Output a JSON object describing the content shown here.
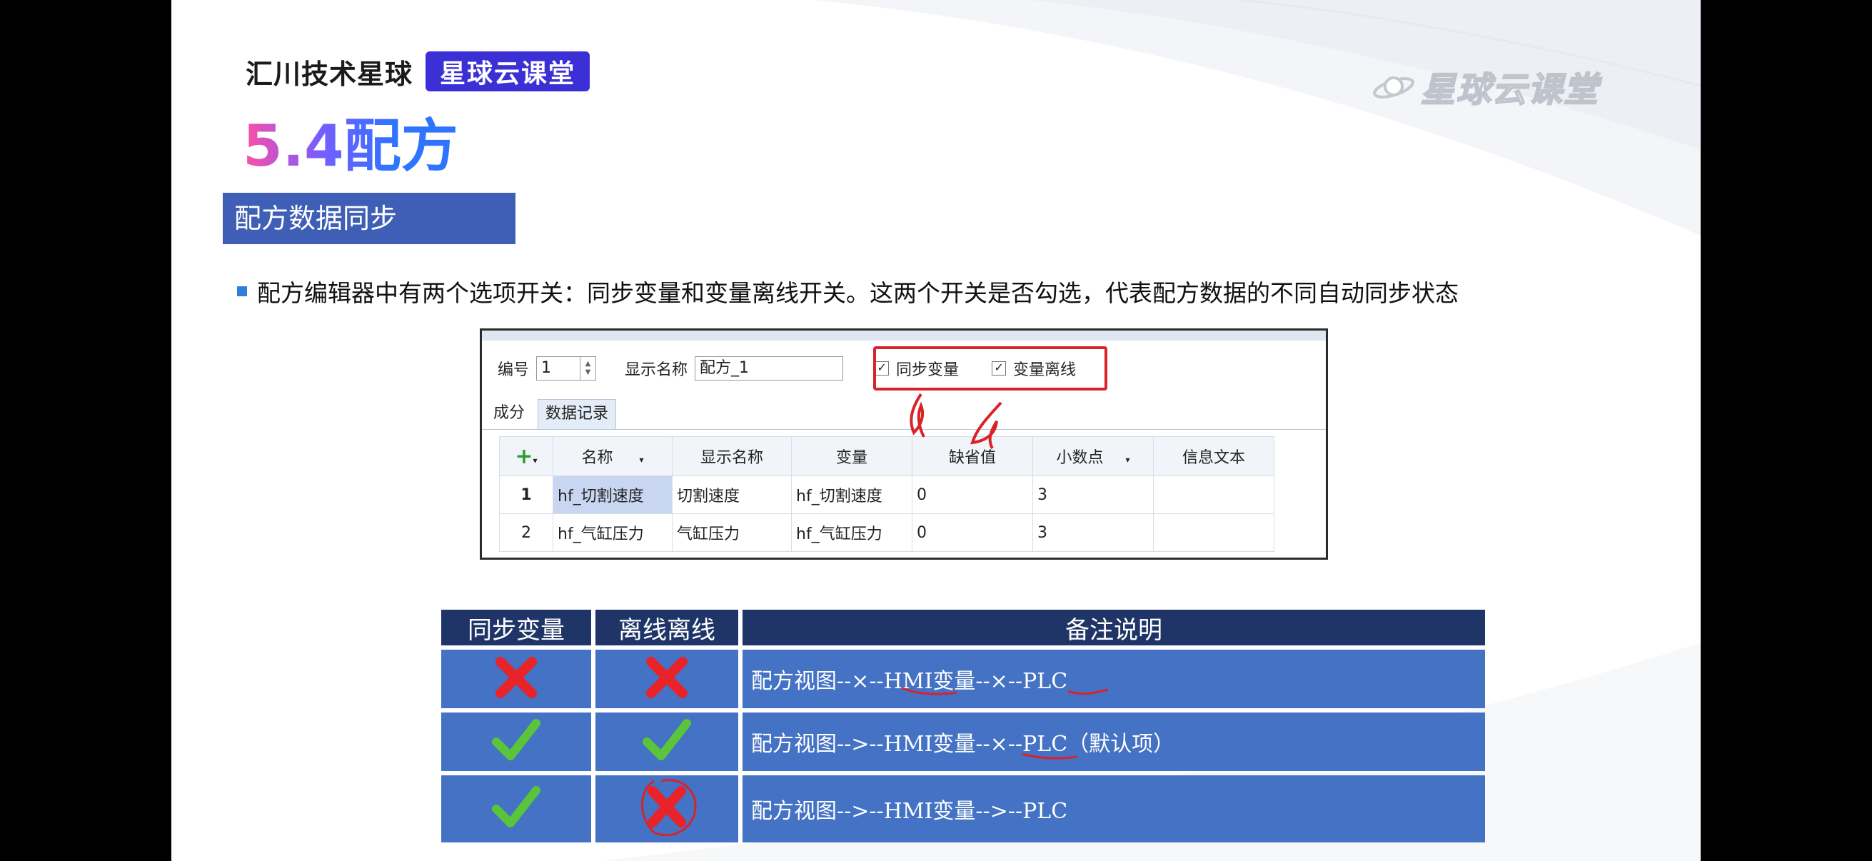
{
  "brand": {
    "name": "汇川技术星球",
    "badge": "星球云课堂"
  },
  "logo": {
    "text": "星球云课堂"
  },
  "title": "5.4配方",
  "section": "配方数据同步",
  "bullet": "配方编辑器中有两个选项开关：同步变量和变量离线开关。这两个开关是否勾选，代表配方数据的不同自动同步状态",
  "editor": {
    "number_label": "编号",
    "number_value": "1",
    "display_name_label": "显示名称",
    "display_name_value": "配方_1",
    "sync_var_label": "同步变量",
    "var_offline_label": "变量离线",
    "tabs": [
      "成分",
      "数据记录"
    ],
    "columns": [
      "名称",
      "显示名称",
      "变量",
      "缺省值",
      "小数点",
      "信息文本"
    ],
    "rows": [
      [
        "1",
        "hf_切割速度",
        "切割速度",
        "hf_切割速度",
        "0",
        "3",
        ""
      ],
      [
        "2",
        "hf_气缸压力",
        "气缸压力",
        "hf_气缸压力",
        "0",
        "3",
        ""
      ]
    ]
  },
  "status_table": {
    "headers": [
      "同步变量",
      "离线离线",
      "备注说明"
    ],
    "rows": [
      {
        "sync": "cross",
        "offline": "cross",
        "note": "配方视图--×--HMI变量--×--PLC"
      },
      {
        "sync": "check",
        "offline": "check",
        "note": "配方视图-->--HMI变量--×--PLC（默认项）"
      },
      {
        "sync": "check",
        "offline": "cross",
        "note": "配方视图-->--HMI变量-->--PLC"
      }
    ]
  },
  "colors": {
    "section_bar": "#3f5fb6",
    "table_header": "#1f3568",
    "table_cell": "#4472c4",
    "annotation": "#d9232a"
  }
}
